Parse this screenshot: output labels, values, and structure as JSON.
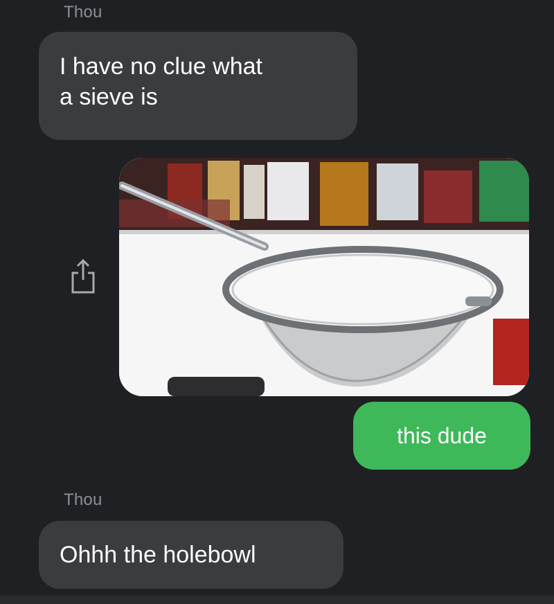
{
  "messages": {
    "first": {
      "sender": "Thou",
      "text_line1": "I have no clue what",
      "text_line2": "a sieve is"
    },
    "reply_image": {
      "icon": "share-icon",
      "depicts": "sieve"
    },
    "reply_text": {
      "text": "this dude"
    },
    "second": {
      "sender": "Thou",
      "text": "Ohhh the holebowl"
    }
  },
  "colors": {
    "background": "#1f2023",
    "incoming_bubble": "#3b3c40",
    "outgoing_bubble": "#3fb85a",
    "sender_text": "#8d8f94"
  }
}
